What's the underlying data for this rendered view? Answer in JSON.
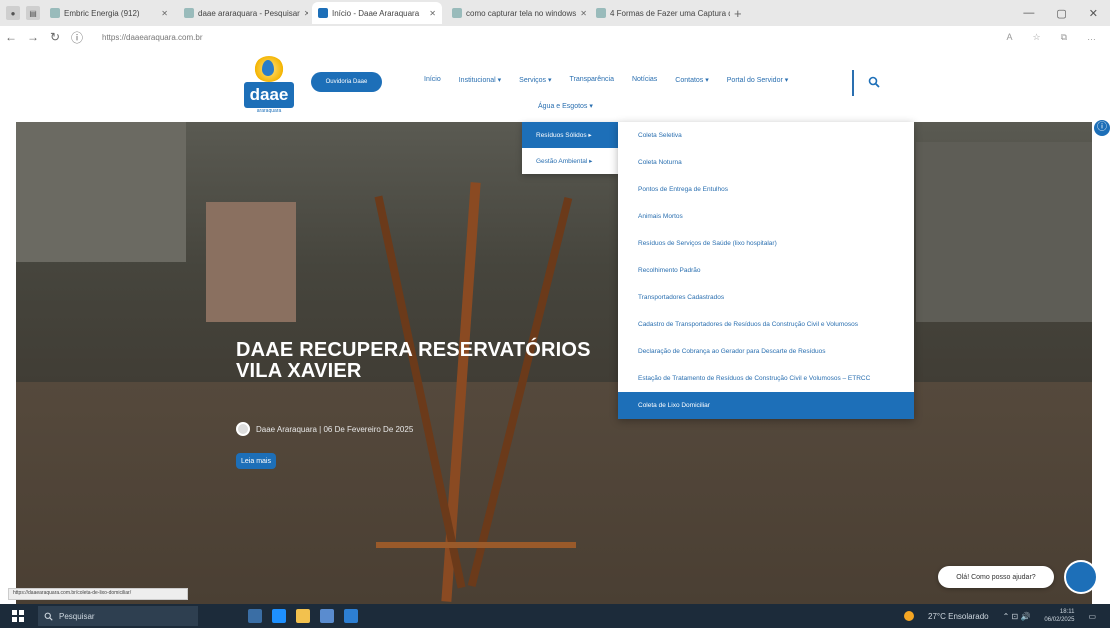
{
  "browser": {
    "tabs": [
      {
        "label": "Embric Energia (912)",
        "active": false
      },
      {
        "label": "daae araraquara - Pesquisar",
        "active": false
      },
      {
        "label": "Início - Daae Araraquara",
        "active": true
      },
      {
        "label": "como capturar tela no windows",
        "active": false
      },
      {
        "label": "4 Formas de Fazer uma Captura d",
        "active": false
      }
    ],
    "new_tab": "+",
    "window_controls": [
      "—",
      "▢",
      "✕"
    ],
    "nav": {
      "back": "←",
      "forward": "→",
      "reload": "↻",
      "info": "ⓘ"
    },
    "url": "https://daaearaquara.com.br"
  },
  "site": {
    "logo": {
      "word": "daae",
      "sub": "araraquara"
    },
    "ouvidoria_label": "Ouvidoria Daae",
    "nav_items": [
      "Início",
      "Institucional ▾",
      "Serviços ▾",
      "Transparência",
      "Notícias",
      "Contatos ▾",
      "Portal do Servidor ▾"
    ],
    "agua_label": "Água e Esgotos ▾",
    "submenu1": [
      {
        "label": "Resíduos Sólidos ▸",
        "active": true
      },
      {
        "label": "Gestão Ambiental ▸",
        "active": false
      }
    ],
    "submenu2": [
      {
        "label": "Coleta Seletiva",
        "active": false
      },
      {
        "label": "Coleta Noturna",
        "active": false
      },
      {
        "label": "Pontos de Entrega de Entulhos",
        "active": false
      },
      {
        "label": "Animais Mortos",
        "active": false
      },
      {
        "label": "Resíduos de Serviços de Saúde (lixo hospitalar)",
        "active": false
      },
      {
        "label": "Recolhimento Padrão",
        "active": false
      },
      {
        "label": "Transportadores Cadastrados",
        "active": false
      },
      {
        "label": "Cadastro de Transportadores de Resíduos da Construção Civil e Volumosos",
        "active": false
      },
      {
        "label": "Declaração de Cobrança ao Gerador para Descarte de Resíduos",
        "active": false
      },
      {
        "label": "Estação de Tratamento de Resíduos de Construção Civil e Volumosos – ETRCC",
        "active": false
      },
      {
        "label": "Coleta de Lixo Domiciliar",
        "active": true
      }
    ],
    "headline_line1": "DAAE RECUPERA RESERVATÓRIOS",
    "headline_line2": "VILA XAVIER",
    "post_meta": "Daae Araraquara | 06 De Fevereiro De 2025",
    "read_more": "Leia mais",
    "accessibility": "ⓘ",
    "chat_prompt": "Olá! Como posso ajudar?"
  },
  "status_url": "https://daaearaquara.com.br/coleta-de-lixo-domiciliar/",
  "taskbar": {
    "search_placeholder": "Pesquisar",
    "weather": "27°C  Ensolarado",
    "time": "18:11",
    "date": "06/02/2025"
  },
  "colors": {
    "brand": "#1d6fb8",
    "nav_text": "#2a6fb0"
  }
}
